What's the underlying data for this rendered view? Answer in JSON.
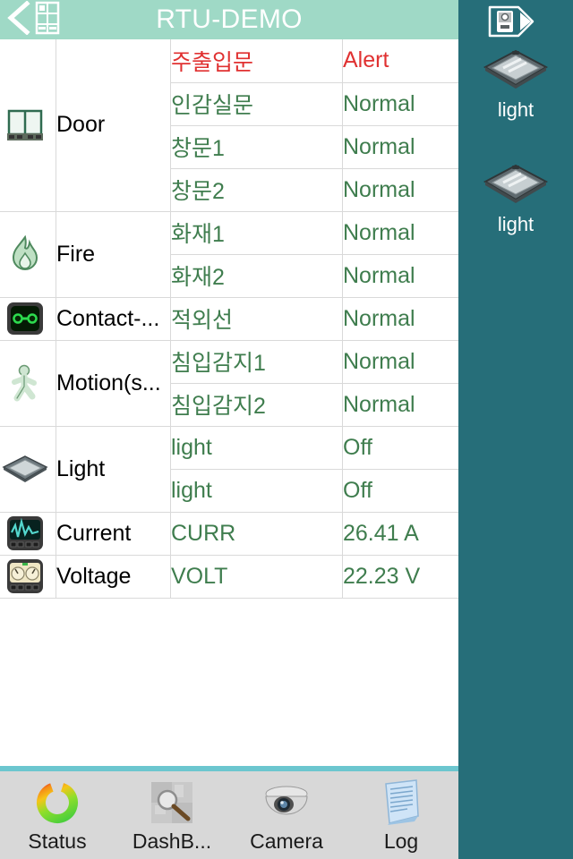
{
  "header": {
    "title": "RTU-DEMO",
    "back_icon": "back-chevron-icon",
    "grid_icon": "building-grid-icon"
  },
  "device_sidebar": {
    "toggle_icon": "device-panel-toggle-icon",
    "items": [
      {
        "label": "light",
        "icon": "ceiling-light-icon"
      },
      {
        "label": "light",
        "icon": "ceiling-light-icon"
      }
    ]
  },
  "table": {
    "rows": [
      {
        "group": "Door",
        "icon": "door-icon",
        "group_rowspan": 4,
        "name": "주출입문",
        "value": "Alert",
        "state": "alert"
      },
      {
        "group": "",
        "icon": "",
        "name": "인감실문",
        "value": "Normal",
        "state": "normal"
      },
      {
        "group": "",
        "icon": "",
        "name": "창문1",
        "value": "Normal",
        "state": "normal"
      },
      {
        "group": "",
        "icon": "",
        "name": "창문2",
        "value": "Normal",
        "state": "normal"
      },
      {
        "group": "Fire",
        "icon": "fire-icon",
        "group_rowspan": 2,
        "name": "화재1",
        "value": "Normal",
        "state": "normal"
      },
      {
        "group": "",
        "icon": "",
        "name": "화재2",
        "value": "Normal",
        "state": "normal"
      },
      {
        "group": "Contact-...",
        "icon": "contact-sensor-icon",
        "group_rowspan": 1,
        "name": "적외선",
        "value": "Normal",
        "state": "normal"
      },
      {
        "group": "Motion(s...",
        "icon": "motion-sensor-icon",
        "group_rowspan": 2,
        "name": "침입감지1",
        "value": "Normal",
        "state": "normal"
      },
      {
        "group": "",
        "icon": "",
        "name": "침입감지2",
        "value": "Normal",
        "state": "normal"
      },
      {
        "group": "Light",
        "icon": "ceiling-light-icon",
        "group_rowspan": 2,
        "name": "light",
        "value": "Off",
        "state": "normal"
      },
      {
        "group": "",
        "icon": "",
        "name": "light",
        "value": "Off",
        "state": "normal"
      },
      {
        "group": "Current",
        "icon": "current-meter-icon",
        "group_rowspan": 1,
        "name": "CURR",
        "value": "26.41 A",
        "state": "normal"
      },
      {
        "group": "Voltage",
        "icon": "voltage-meter-icon",
        "group_rowspan": 1,
        "name": "VOLT",
        "value": "22.23 V",
        "state": "normal"
      }
    ]
  },
  "tabbar": {
    "tabs": [
      {
        "label": "Status",
        "icon": "status-donut-icon"
      },
      {
        "label": "DashB...",
        "icon": "dashboard-magnifier-icon"
      },
      {
        "label": "Camera",
        "icon": "dome-camera-icon"
      },
      {
        "label": "Log",
        "icon": "log-document-icon"
      }
    ]
  },
  "colors": {
    "header_bg": "#9fd9c6",
    "sidebar_bg": "#266e79",
    "alert": "#e03131",
    "normal": "#3f7d4e",
    "footer_bg": "#d8d8d8",
    "footer_divider": "#6cc6cf"
  }
}
